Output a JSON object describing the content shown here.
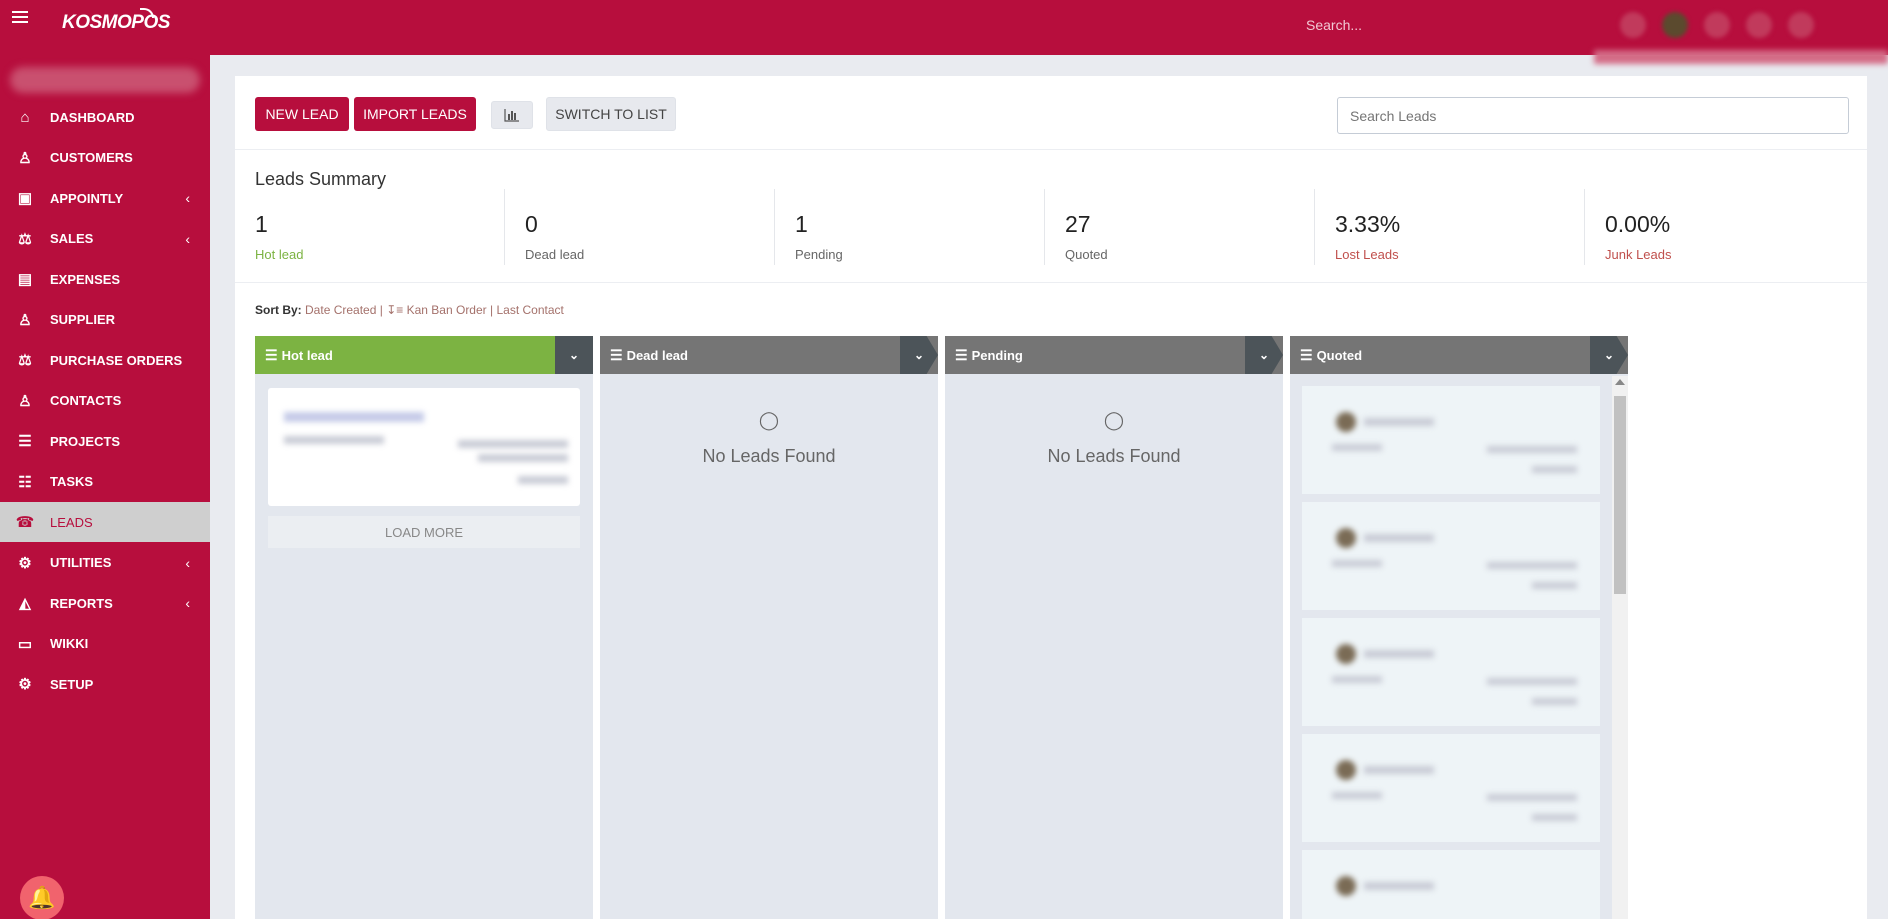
{
  "topbar": {
    "logo": "KOSMOPOS",
    "search_placeholder": "Search..."
  },
  "sidebar": {
    "items": [
      {
        "label": "DASHBOARD",
        "icon": "home-icon",
        "glyph": "⌂"
      },
      {
        "label": "CUSTOMERS",
        "icon": "user-icon",
        "glyph": "♙"
      },
      {
        "label": "APPOINTLY",
        "icon": "calendar-check-icon",
        "glyph": "▣"
      },
      {
        "label": "SALES",
        "icon": "balance-scale-icon",
        "glyph": "⚖"
      },
      {
        "label": "EXPENSES",
        "icon": "file-text-icon",
        "glyph": "▤"
      },
      {
        "label": "SUPPLIER",
        "icon": "user-icon",
        "glyph": "♙"
      },
      {
        "label": "PURCHASE ORDERS",
        "icon": "balance-scale-icon",
        "glyph": "⚖"
      },
      {
        "label": "CONTACTS",
        "icon": "user-icon",
        "glyph": "♙"
      },
      {
        "label": "PROJECTS",
        "icon": "bars-icon",
        "glyph": "☰"
      },
      {
        "label": "TASKS",
        "icon": "tasks-icon",
        "glyph": "☷"
      },
      {
        "label": "LEADS",
        "icon": "tty-icon",
        "glyph": "☎"
      },
      {
        "label": "UTILITIES",
        "icon": "cogs-icon",
        "glyph": "⚙"
      },
      {
        "label": "REPORTS",
        "icon": "area-chart-icon",
        "glyph": "◭"
      },
      {
        "label": "WIKKI",
        "icon": "folder-open-icon",
        "glyph": "▭"
      },
      {
        "label": "SETUP",
        "icon": "cog-icon",
        "glyph": "⚙"
      }
    ],
    "active": "LEADS"
  },
  "toolbar": {
    "new_lead": "NEW LEAD",
    "import_leads": "IMPORT LEADS",
    "switch_to_list": "SWITCH TO LIST",
    "search_placeholder": "Search Leads"
  },
  "summary": {
    "title": "Leads Summary",
    "stats": [
      {
        "value": "1",
        "label": "Hot lead",
        "color": "#7cb342"
      },
      {
        "value": "0",
        "label": "Dead lead",
        "color": "#666666"
      },
      {
        "value": "1",
        "label": "Pending",
        "color": "#666666"
      },
      {
        "value": "27",
        "label": "Quoted",
        "color": "#666666"
      },
      {
        "value": "3.33%",
        "label": "Lost Leads",
        "color": "#c0504d"
      },
      {
        "value": "0.00%",
        "label": "Junk Leads",
        "color": "#c0504d"
      }
    ]
  },
  "sort": {
    "label": "Sort By:",
    "date_created": "Date Created",
    "kanban_order": "Kan Ban Order",
    "last_contact": "Last Contact",
    "sep": "|"
  },
  "kanban": {
    "columns": [
      {
        "title": "Hot lead",
        "color": "#7cb342"
      },
      {
        "title": "Dead lead",
        "color": "#757575",
        "empty": "No Leads Found"
      },
      {
        "title": "Pending",
        "color": "#757575",
        "empty": "No Leads Found"
      },
      {
        "title": "Quoted",
        "color": "#757575"
      }
    ],
    "load_more": "LOAD MORE"
  },
  "colors": {
    "brand": "#b70e3d",
    "hot": "#7cb342",
    "column_header": "#757575"
  }
}
